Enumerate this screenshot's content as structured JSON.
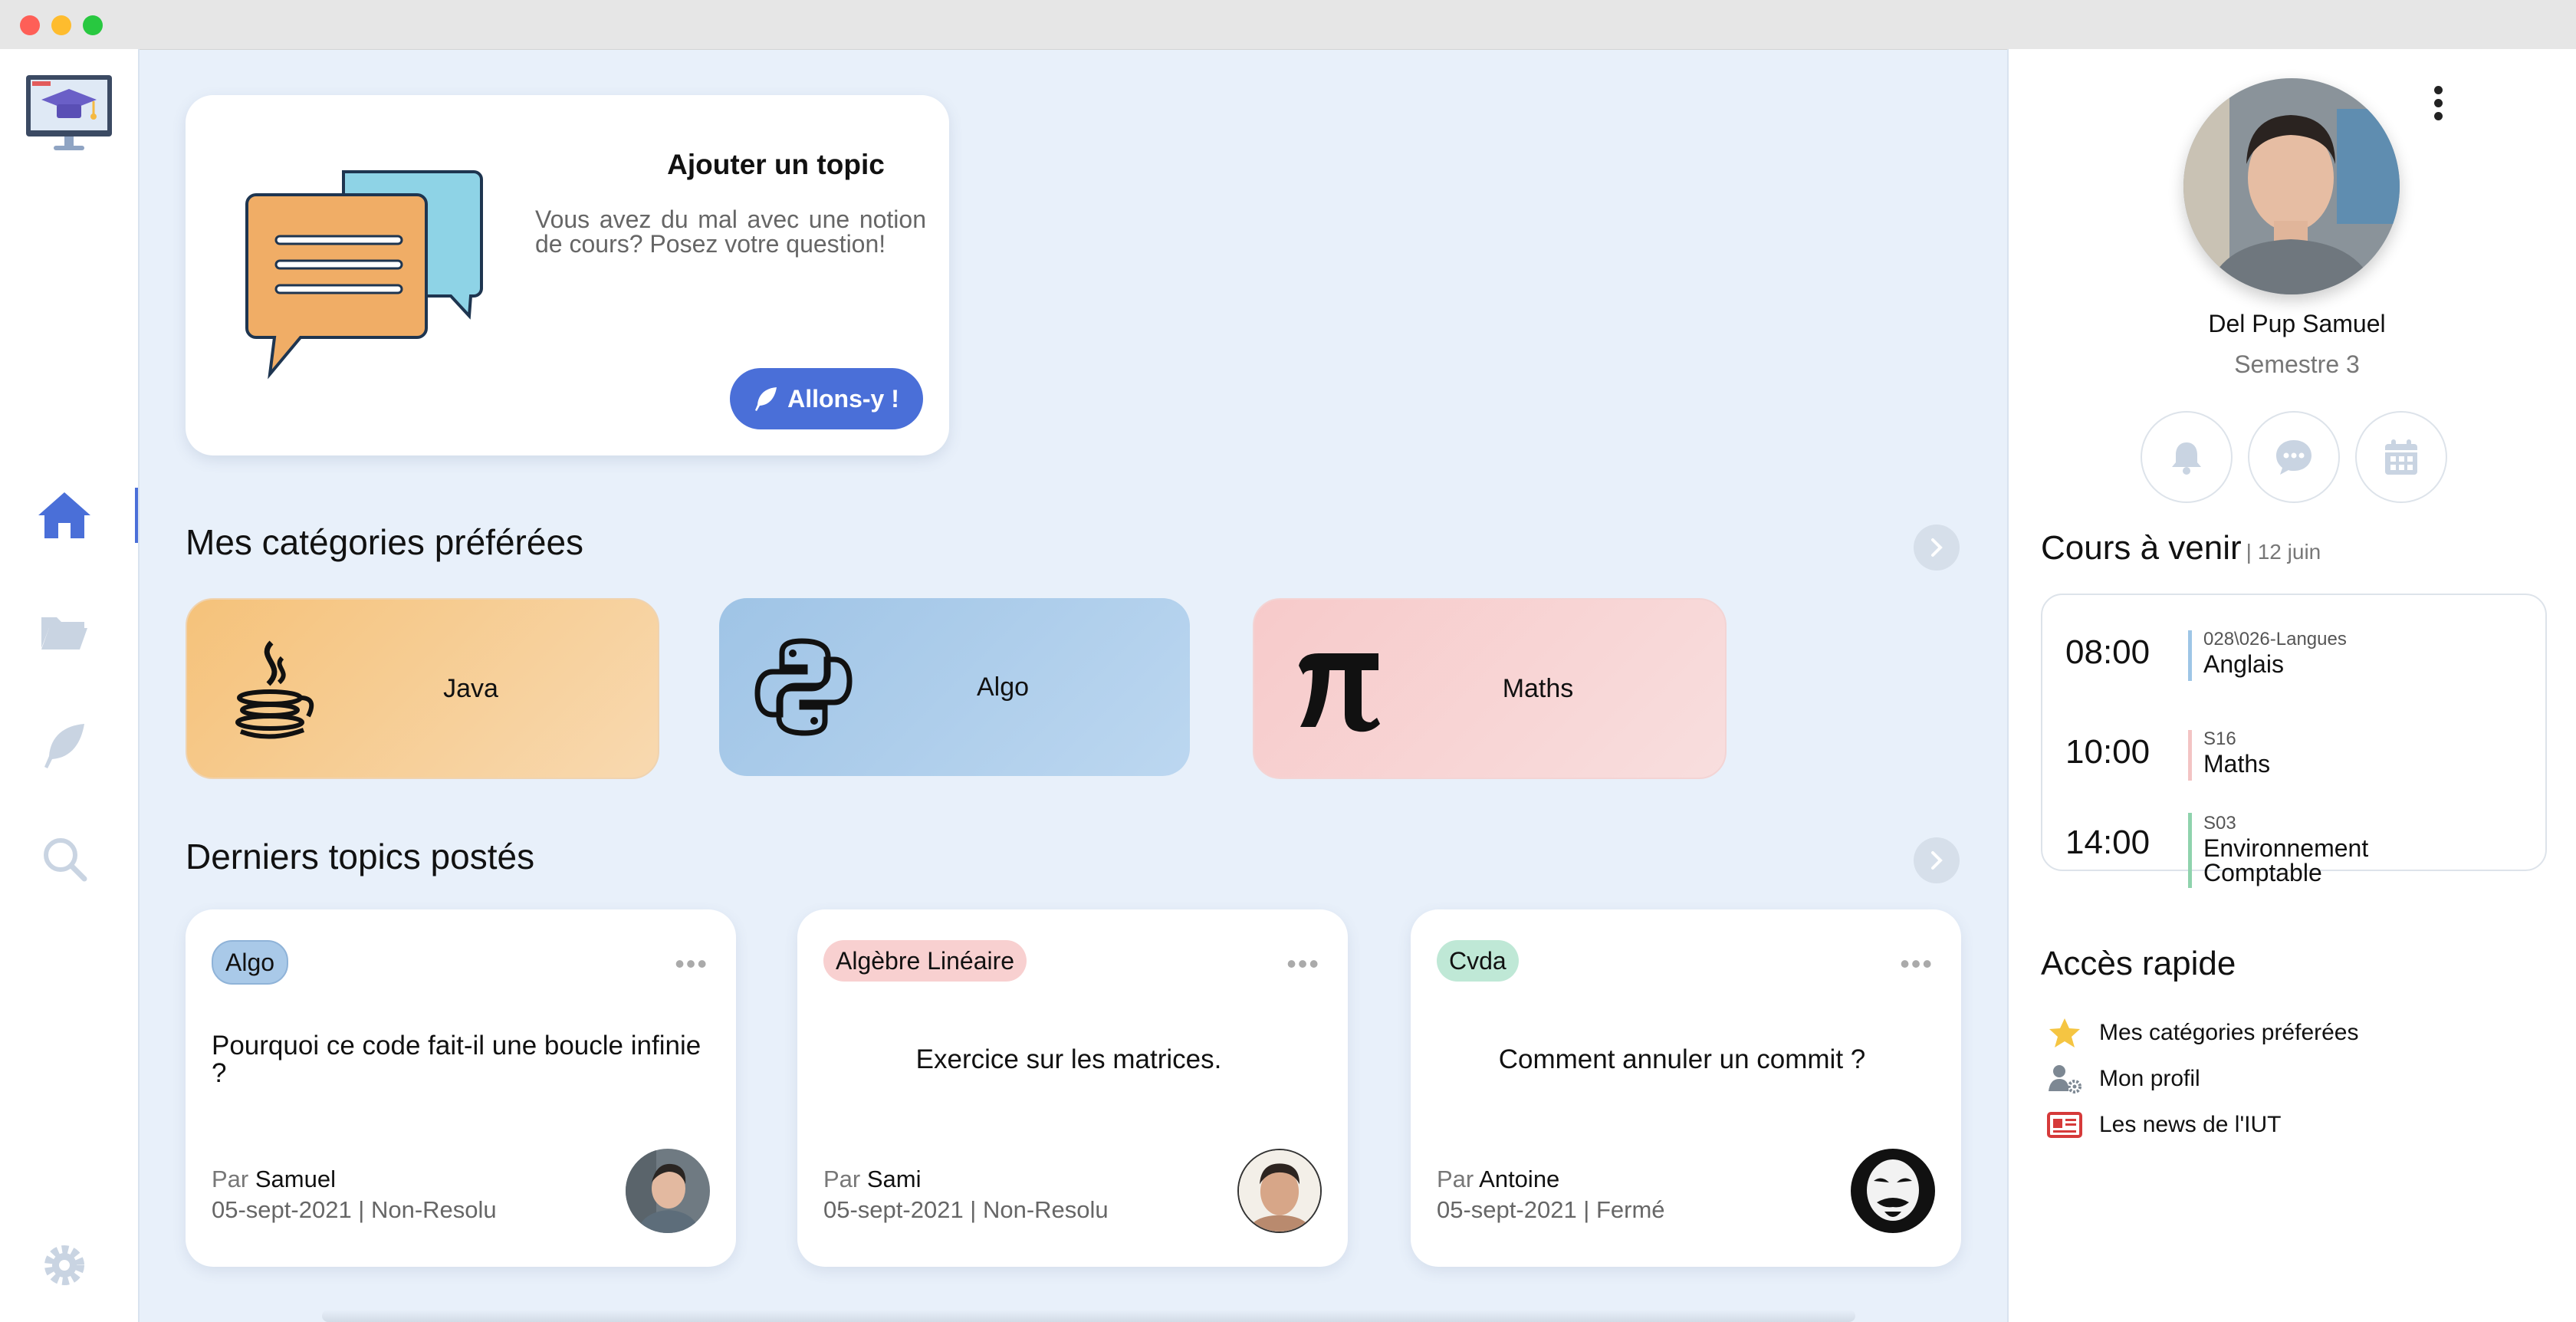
{
  "add_topic": {
    "title": "Ajouter un topic",
    "description": "Vous avez du mal avec une notion de cours? Posez votre question!",
    "button": "Allons-y !"
  },
  "categories_section": {
    "title": "Mes catégories préférées",
    "items": [
      {
        "label": "Java",
        "icon": "java-icon"
      },
      {
        "label": "Algo",
        "icon": "python-icon"
      },
      {
        "label": "Maths",
        "icon": "pi-icon"
      }
    ]
  },
  "topics_section": {
    "title": "Derniers topics postés",
    "items": [
      {
        "tag": "Algo",
        "tag_color": "#a9c9e8",
        "question": "Pourquoi ce code fait-il une boucle infinie ?",
        "by_prefix": "Par",
        "author": "Samuel",
        "meta": "05-sept-2021 | Non-Resolu"
      },
      {
        "tag": "Algèbre Linéaire",
        "tag_color": "#f8d0d0",
        "question": "Exercice sur les matrices.",
        "by_prefix": "Par",
        "author": "Sami",
        "meta": "05-sept-2021 | Non-Resolu"
      },
      {
        "tag": "Cvda",
        "tag_color": "#bfe8d6",
        "question": "Comment annuler un commit ?",
        "by_prefix": "Par",
        "author": "Antoine",
        "meta": "05-sept-2021 | Fermé"
      }
    ]
  },
  "profile": {
    "name": "Del Pup Samuel",
    "semester": "Semestre 3"
  },
  "upcoming": {
    "title": "Cours à venir",
    "date": "| 12 juin",
    "slots": [
      {
        "time": "08:00",
        "room": "028\\026-Langues",
        "course": "Anglais",
        "color": "#9ec6e6"
      },
      {
        "time": "10:00",
        "room": "S16",
        "course": "Maths",
        "color": "#f3c4c4"
      },
      {
        "time": "14:00",
        "room": "S03",
        "course": "Environnement Comptable",
        "color": "#8fd3ad"
      }
    ]
  },
  "quick_access": {
    "title": "Accès rapide",
    "items": [
      {
        "label": "Mes catégories préferées",
        "icon": "star-icon"
      },
      {
        "label": "Mon profil",
        "icon": "user-gear-icon"
      },
      {
        "label": "Les news de l'IUT",
        "icon": "newspaper-icon"
      }
    ]
  },
  "colors": {
    "accent": "#4a6fd8",
    "background": "#e8f0fa"
  }
}
